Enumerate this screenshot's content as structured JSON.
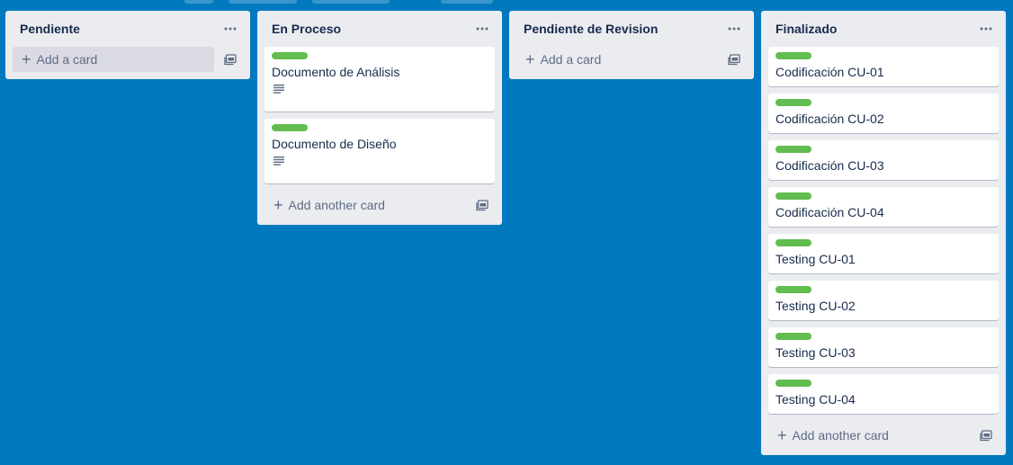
{
  "lists": [
    {
      "title": "Pendiente",
      "cards": [],
      "add_label": "Add a card"
    },
    {
      "title": "En Proceso",
      "cards": [
        {
          "title": "Documento de Análisis",
          "label_color": "#61bd4f",
          "has_description": true
        },
        {
          "title": "Documento de Diseño",
          "label_color": "#61bd4f",
          "has_description": true
        }
      ],
      "add_label": "Add another card"
    },
    {
      "title": "Pendiente de Revision",
      "cards": [],
      "add_label": "Add a card"
    },
    {
      "title": "Finalizado",
      "cards": [
        {
          "title": "Codificación CU-01",
          "label_color": "#61bd4f",
          "has_description": false
        },
        {
          "title": "Codificación CU-02",
          "label_color": "#61bd4f",
          "has_description": false
        },
        {
          "title": "Codificación CU-03",
          "label_color": "#61bd4f",
          "has_description": false
        },
        {
          "title": "Codificación CU-04",
          "label_color": "#61bd4f",
          "has_description": false
        },
        {
          "title": "Testing CU-01",
          "label_color": "#61bd4f",
          "has_description": false
        },
        {
          "title": "Testing CU-02",
          "label_color": "#61bd4f",
          "has_description": false
        },
        {
          "title": "Testing CU-03",
          "label_color": "#61bd4f",
          "has_description": false
        },
        {
          "title": "Testing CU-04",
          "label_color": "#61bd4f",
          "has_description": false
        }
      ],
      "add_label": "Add another card"
    }
  ],
  "colors": {
    "board_bg": "#0079bf",
    "list_bg": "#ebecf0",
    "label_green": "#61bd4f",
    "text": "#172b4d",
    "muted": "#5e6c84"
  },
  "icons": {
    "list_menu": "ellipsis-icon",
    "add": "plus-icon",
    "template": "card-template-icon",
    "description": "description-icon"
  }
}
